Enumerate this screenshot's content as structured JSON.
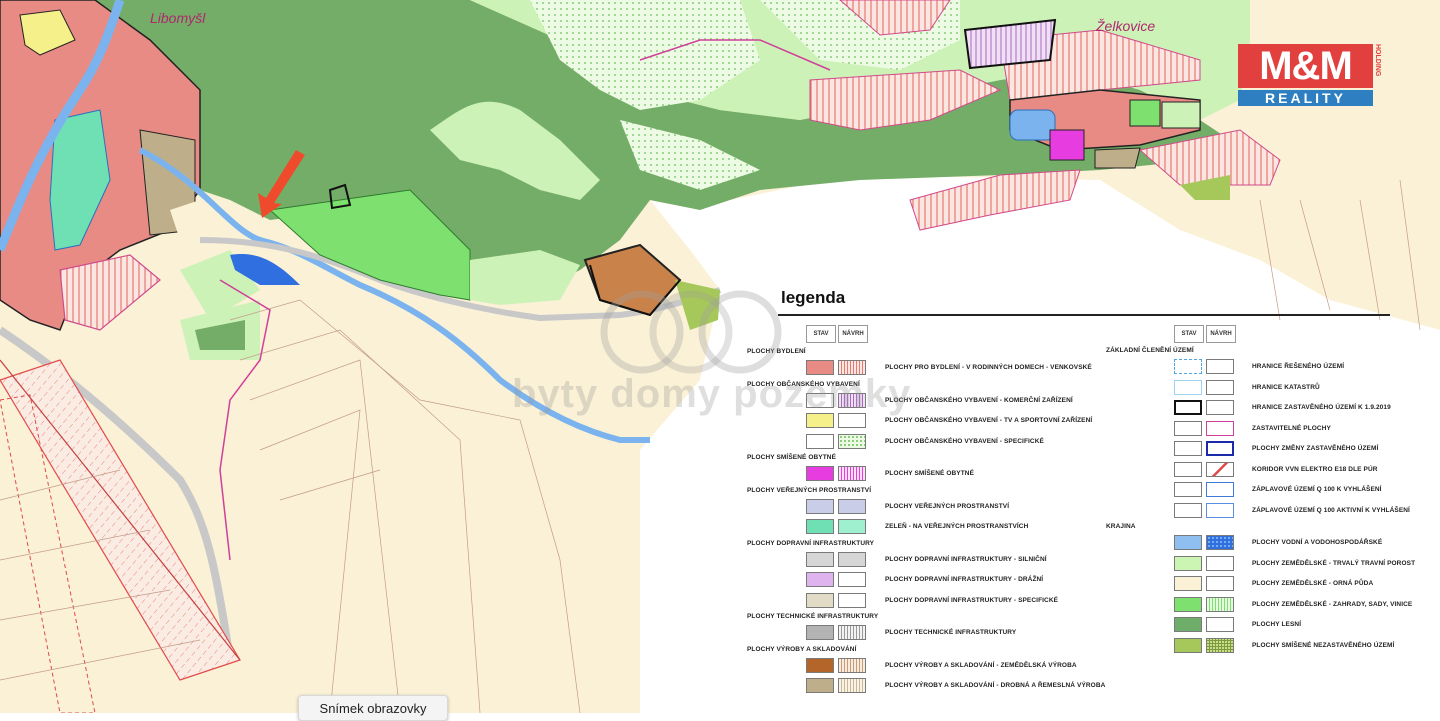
{
  "map": {
    "places": {
      "libomysl": "Libomyšl",
      "zelkovice": "Želkovice"
    },
    "arrow_color": "#ef4a2b"
  },
  "legend": {
    "title": "legenda",
    "stav": "STAV",
    "navrh": "NÁVRH",
    "left": [
      {
        "kind": "section",
        "label": "PLOCHY BYDLENÍ"
      },
      {
        "kind": "item",
        "label": "PLOCHY PRO BYDLENÍ - V RODINNÝCH DOMECH - VENKOVSKÉ",
        "stav": "#e88b85",
        "navrh": "hatch-red"
      },
      {
        "kind": "section",
        "label": "PLOCHY  OBČANSKÉHO VYBAVENÍ"
      },
      {
        "kind": "item",
        "label": "PLOCHY OBČANSKÉHO VYBAVENÍ - KOMERČNÍ ZAŘÍZENÍ",
        "stav": "none",
        "navrh": "hatch-purple"
      },
      {
        "kind": "item",
        "label": "PLOCHY OBČANSKÉHO VYBAVENÍ - TV A SPORTOVNÍ ZAŘÍZENÍ",
        "stav": "#f5f08a",
        "navrh": "none"
      },
      {
        "kind": "item",
        "label": "PLOCHY OBČANSKÉHO VYBAVENÍ - SPECIFICKÉ",
        "stav": "#ffffff",
        "navrh": "dots-green"
      },
      {
        "kind": "section",
        "label": "PLOCHY SMÍŠENÉ OBYTNÉ"
      },
      {
        "kind": "item",
        "label": "PLOCHY SMÍŠENÉ OBYTNÉ",
        "stav": "#e63ce0",
        "navrh": "hatch-magenta"
      },
      {
        "kind": "section",
        "label": "PLOCHY VEŘEJNÝCH PROSTRANSTVÍ"
      },
      {
        "kind": "item",
        "label": "PLOCHY VEŘEJNÝCH PROSTRANSTVÍ",
        "stav": "#c9cde8",
        "navrh": "#c9cde8"
      },
      {
        "kind": "item",
        "label": "ZELEŇ - NA VEŘEJNÝCH PROSTRANSTVÍCH",
        "stav": "#6fe0b4",
        "navrh": "#9ff0cf"
      },
      {
        "kind": "section",
        "label": "PLOCHY DOPRAVNÍ INFRASTRUKTURY"
      },
      {
        "kind": "item",
        "label": "PLOCHY DOPRAVNÍ INFRASTRUKTURY - SILNIČNÍ",
        "stav": "#d6d6d6",
        "navrh": "#d6d6d6"
      },
      {
        "kind": "item",
        "label": "PLOCHY DOPRAVNÍ INFRASTRUKTURY - DRÁŽNÍ",
        "stav": "#dfb3ee",
        "navrh": "#ffffff"
      },
      {
        "kind": "item",
        "label": "PLOCHY DOPRAVNÍ INFRASTRUKTURY - SPECIFICKÉ",
        "stav": "#e2dcc7",
        "navrh": "#ffffff"
      },
      {
        "kind": "section",
        "label": "PLOCHY TECHNICKÉ INFRASTRUKTURY"
      },
      {
        "kind": "item",
        "label": "PLOCHY TECHNICKÉ INFRASTRUKTURY",
        "stav": "#b3b3b3",
        "navrh": "hatch-grey"
      },
      {
        "kind": "section",
        "label": "PLOCHY VÝROBY A SKLADOVÁNÍ"
      },
      {
        "kind": "item",
        "label": "PLOCHY VÝROBY A SKLADOVÁNÍ - ZEMĚDĚLSKÁ VÝROBA",
        "stav": "#b3652a",
        "navrh": "hatch-brown"
      },
      {
        "kind": "item",
        "label": "PLOCHY VÝROBY A SKLADOVÁNÍ - DROBNÁ A ŘEMESLNÁ VÝROBA",
        "stav": "#bfae8a",
        "navrh": "hatch-tan"
      }
    ],
    "right": [
      {
        "kind": "section",
        "label": "ZÁKLADNÍ ČLENĚNÍ ÚZEMÍ"
      },
      {
        "kind": "item",
        "label": "HRANICE ŘEŠENÉHO ÚZEMÍ",
        "stav": "dash-blue",
        "navrh": "none"
      },
      {
        "kind": "item",
        "label": "HRANICE KATASTRŮ",
        "stav": "line-lightblue",
        "navrh": "none"
      },
      {
        "kind": "item",
        "label": "HRANICE ZASTAVĚNÉHO ÚZEMÍ K 1.9.2019",
        "stav": "border-black",
        "navrh": "none"
      },
      {
        "kind": "item",
        "label": "ZASTAVITELNÉ PLOCHY",
        "stav": "none",
        "navrh": "border-magenta"
      },
      {
        "kind": "item",
        "label": "PLOCHY ZMĚNY ZASTAVĚNÉHO ÚZEMÍ",
        "stav": "none",
        "navrh": "border-navy"
      },
      {
        "kind": "item",
        "label": "KORIDOR VVN ELEKTRO E18 DLE PÚR",
        "stav": "none",
        "navrh": "diag-red"
      },
      {
        "kind": "item",
        "label": "ZÁPLAVOVÉ ÚZEMÍ Q 100 K VYHLÁŠENÍ",
        "stav": "none",
        "navrh": "line-blue"
      },
      {
        "kind": "item",
        "label": "ZÁPLAVOVÉ ÚZEMÍ Q 100 AKTIVNÍ K VYHLÁŠENÍ",
        "stav": "none",
        "navrh": "line-blue2"
      },
      {
        "kind": "section",
        "label": "KRAJINA"
      },
      {
        "kind": "item",
        "label": "PLOCHY VODNÍ A VODOHOSPODÁŘSKÉ",
        "stav": "#8fbff0",
        "navrh": "dots-blue"
      },
      {
        "kind": "item",
        "label": "PLOCHY ZEMĚDĚLSKÉ - TRVALÝ TRAVNÍ POROST",
        "stav": "#ccf5b3",
        "navrh": "#ffffff"
      },
      {
        "kind": "item",
        "label": "PLOCHY ZEMĚDĚLSKÉ - ORNÁ PŮDA",
        "stav": "#faf1d6",
        "navrh": "#ffffff"
      },
      {
        "kind": "item",
        "label": "PLOCHY ZEMĚDĚLSKÉ - ZAHRADY, SADY, VINICE",
        "stav": "#7ee06e",
        "navrh": "hatch-green"
      },
      {
        "kind": "item",
        "label": "PLOCHY LESNÍ",
        "stav": "#6fae6a",
        "navrh": "#ffffff"
      },
      {
        "kind": "item",
        "label": "PLOCHY SMÍŠENÉ NEZASTAVĚNÉHO ÚZEMÍ",
        "stav": "#a6c85a",
        "navrh": "grid-olive"
      }
    ]
  },
  "logo": {
    "brand": "M&M",
    "sub": "REALITY",
    "side": "HOLDING"
  },
  "watermark": {
    "text": "byty domy pozemky"
  },
  "tooltip": {
    "text": "Snímek obrazovky"
  }
}
